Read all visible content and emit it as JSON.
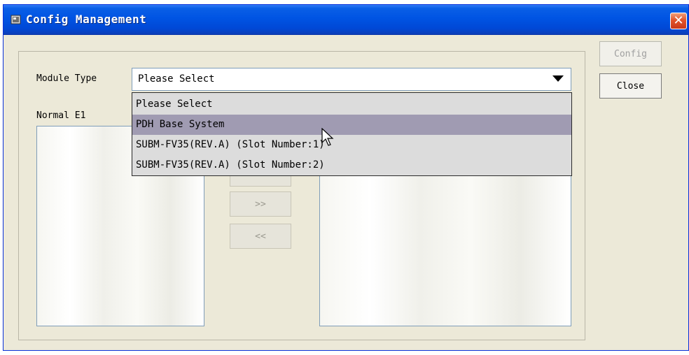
{
  "window": {
    "title": "Config Management",
    "close_glyph": "✕",
    "icon": "app-window-icon"
  },
  "module_type": {
    "label": "Module Type",
    "value": "Please Select",
    "options": [
      "Please Select",
      "PDH Base System",
      "SUBM-FV35(REV.A) (Slot Number:1)",
      "SUBM-FV35(REV.A) (Slot Number:2)"
    ],
    "highlighted_index": 1
  },
  "left_list": {
    "label": "Normal E1"
  },
  "transfer": {
    "move_right": ">>",
    "move_left": "<<"
  },
  "buttons": {
    "config": "Config",
    "close": "Close"
  },
  "colors": {
    "titlebar": "#0054e3",
    "close_button": "#e2532a",
    "highlight": "#a09bb2",
    "window_bg": "#ece9d8"
  }
}
